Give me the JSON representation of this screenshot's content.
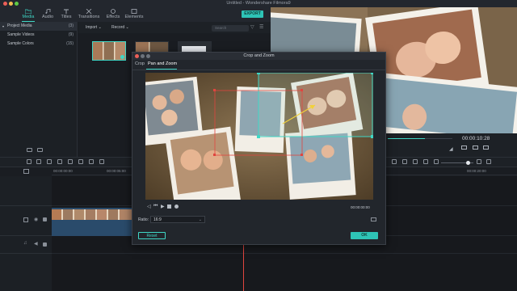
{
  "window": {
    "title": "Untitled - Wondershare Filmora9"
  },
  "nav": {
    "tabs": [
      {
        "label": "Media",
        "icon": "folder-icon",
        "active": true
      },
      {
        "label": "Audio",
        "icon": "music-note-icon",
        "active": false
      },
      {
        "label": "Titles",
        "icon": "text-icon",
        "active": false
      },
      {
        "label": "Transitions",
        "icon": "transition-icon",
        "active": false
      },
      {
        "label": "Effects",
        "icon": "effects-icon",
        "active": false
      },
      {
        "label": "Elements",
        "icon": "elements-icon",
        "active": false
      }
    ],
    "export_label": "EXPORT"
  },
  "library": {
    "items": [
      {
        "label": "Project Media",
        "count": "(3)"
      },
      {
        "label": "Sample Videos",
        "count": "(9)"
      },
      {
        "label": "Sample Colors",
        "count": "(15)"
      }
    ]
  },
  "media_toolbar": {
    "import_label": "Import",
    "record_label": "Record",
    "search_placeholder": "Search"
  },
  "preview": {
    "time": "00:00:10:28",
    "progress": 0.58
  },
  "timeline": {
    "ruler_times": [
      "00:00:00:00",
      "00:00:05:00",
      "00:00:20:00"
    ]
  },
  "modal": {
    "title": "Crop and Zoom",
    "tabs": [
      {
        "label": "Crop",
        "active": false
      },
      {
        "label": "Pan and Zoom",
        "active": true
      }
    ],
    "time": "00:00:00:00",
    "ratio_label": "Ratio:",
    "ratio_value": "16:9",
    "reset_label": "Reset",
    "ok_label": "OK"
  },
  "colors": {
    "accent": "#3fd7c6",
    "panel": "#22262c",
    "playhead": "#e0453f"
  }
}
